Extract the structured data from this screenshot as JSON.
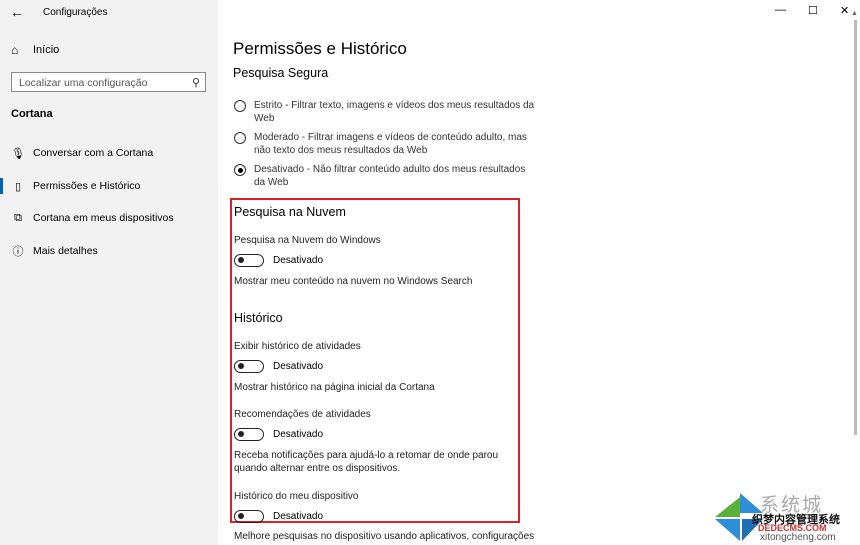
{
  "window": {
    "title": "Configurações",
    "minimize": "—",
    "maximize": "☐",
    "close": "✕"
  },
  "sidebar": {
    "home_label": "Início",
    "search_placeholder": "Localizar uma configuração",
    "section_title": "Cortana",
    "items": [
      {
        "label": "Conversar com a Cortana",
        "icon": "microphone-icon",
        "active": false
      },
      {
        "label": "Permissões e Histórico",
        "icon": "permissions-icon",
        "active": true
      },
      {
        "label": "Cortana em meus dispositivos",
        "icon": "devices-icon",
        "active": false
      },
      {
        "label": "Mais detalhes",
        "icon": "info-icon",
        "active": false
      }
    ]
  },
  "main": {
    "page_title": "Permissões e Histórico",
    "safe_search": {
      "title": "Pesquisa Segura",
      "options": [
        {
          "line1": "Estrito - Filtrar texto, imagens e vídeos dos meus resultados da",
          "line2": "Web",
          "checked": false
        },
        {
          "line1": "Moderado - Filtrar imagens e vídeos de conteúdo adulto, mas",
          "line2": "não texto dos meus resultados da Web",
          "checked": false
        },
        {
          "line1": "Desativado - Não filtrar conteúdo adulto dos meus resultados",
          "line2": "da Web",
          "checked": true
        }
      ]
    },
    "cloud_search": {
      "title": "Pesquisa na Nuvem",
      "setting_label": "Pesquisa na Nuvem do Windows",
      "toggle_state": "Desativado",
      "description": "Mostrar meu conteúdo na nuvem no Windows Search"
    },
    "history": {
      "title": "Histórico",
      "activity_history_label": "Exibir histórico de atividades",
      "activity_history_state": "Desativado",
      "activity_history_desc": "Mostrar histórico na página inicial da Cortana",
      "recommendations_label": "Recomendações de atividades",
      "recommendations_state": "Desativado",
      "recommendations_desc_line1": "Receba notificações para ajudá-lo a retomar de onde parou",
      "recommendations_desc_line2": "quando alternar entre os dispositivos.",
      "device_history_label": "Histórico do meu dispositivo",
      "device_history_state": "Desativado",
      "device_history_desc": "Melhore pesquisas no dispositivo usando aplicativos, configurações"
    }
  },
  "watermark": {
    "cn_title": "系统城",
    "cn_subtitle": "织梦内容管理系统",
    "site1": "DEDECMS.COM",
    "site2": "xitongcheng.com"
  },
  "colors": {
    "accent": "#0063b1",
    "highlight_box": "#d6202a"
  }
}
